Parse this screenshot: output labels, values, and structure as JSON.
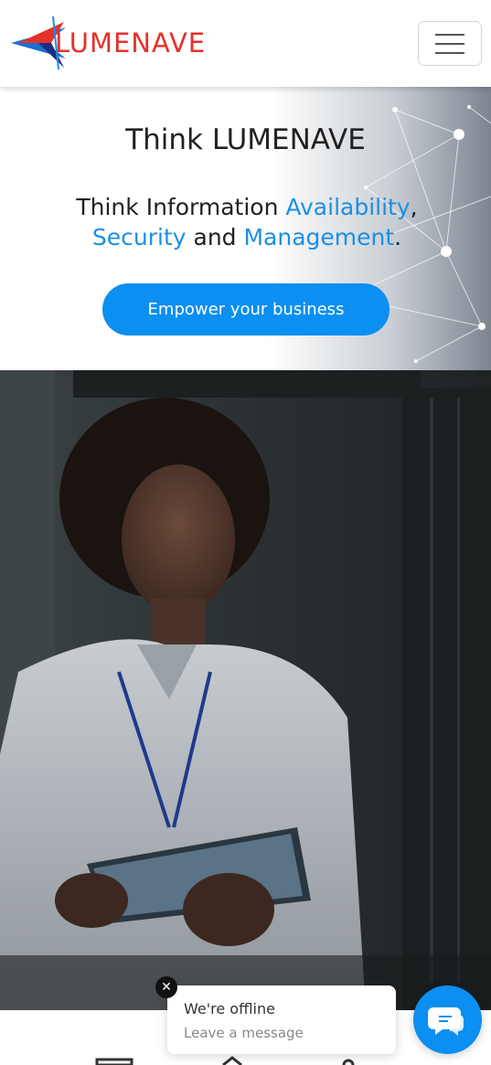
{
  "header": {
    "logo_text": "LUMENAVE",
    "menu_icon": "hamburger-icon"
  },
  "hero": {
    "title": "Think LUMENAVE",
    "sub_prefix": "Think Information ",
    "sub_word1": "Availability",
    "sub_comma": ",",
    "sub_word2": "Security",
    "sub_and": " and ",
    "sub_word3": "Management",
    "sub_period": ".",
    "cta_label": "Empower your business"
  },
  "chat": {
    "title": "We're offline",
    "subtitle": "Leave a message",
    "close_label": "✕",
    "fab_icon": "chat-icon"
  },
  "colors": {
    "brand_red": "#e4312a",
    "brand_blue": "#1b8fe4",
    "cta_blue": "#0b8ff0"
  }
}
